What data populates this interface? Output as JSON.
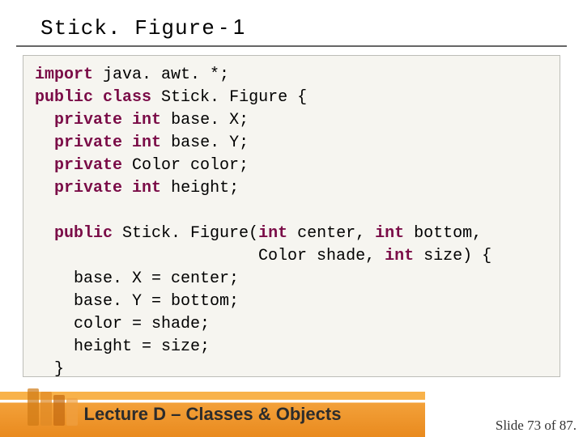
{
  "title": {
    "code": "Stick. Figure",
    "suffix": "- 1"
  },
  "code": {
    "l1a": "import",
    "l1b": " java. awt. *;",
    "l2a": "public",
    "l2b": " ",
    "l2c": "class",
    "l2d": " Stick. Figure {",
    "l3a": "  ",
    "l3b": "private",
    "l3c": " ",
    "l3d": "int",
    "l3e": " base. X;",
    "l4a": "  ",
    "l4b": "private",
    "l4c": " ",
    "l4d": "int",
    "l4e": " base. Y;",
    "l5a": "  ",
    "l5b": "private",
    "l5c": " Color color;",
    "l6a": "  ",
    "l6b": "private",
    "l6c": " ",
    "l6d": "int",
    "l6e": " height;",
    "blank": "",
    "l8a": "  ",
    "l8b": "public",
    "l8c": " Stick. Figure(",
    "l8d": "int",
    "l8e": " center, ",
    "l8f": "int",
    "l8g": " bottom,",
    "l9a": "                       Color shade, ",
    "l9b": "int",
    "l9c": " size) {",
    "l10": "    base. X = center;",
    "l11": "    base. Y = bottom;",
    "l12": "    color = shade;",
    "l13": "    height = size;",
    "l14": "  }"
  },
  "footer": {
    "left": "Lecture D – Classes & Objects",
    "right_prefix": "Slide ",
    "right_current": "73",
    "right_of": " of ",
    "right_total": "87",
    "right_suffix": "."
  }
}
